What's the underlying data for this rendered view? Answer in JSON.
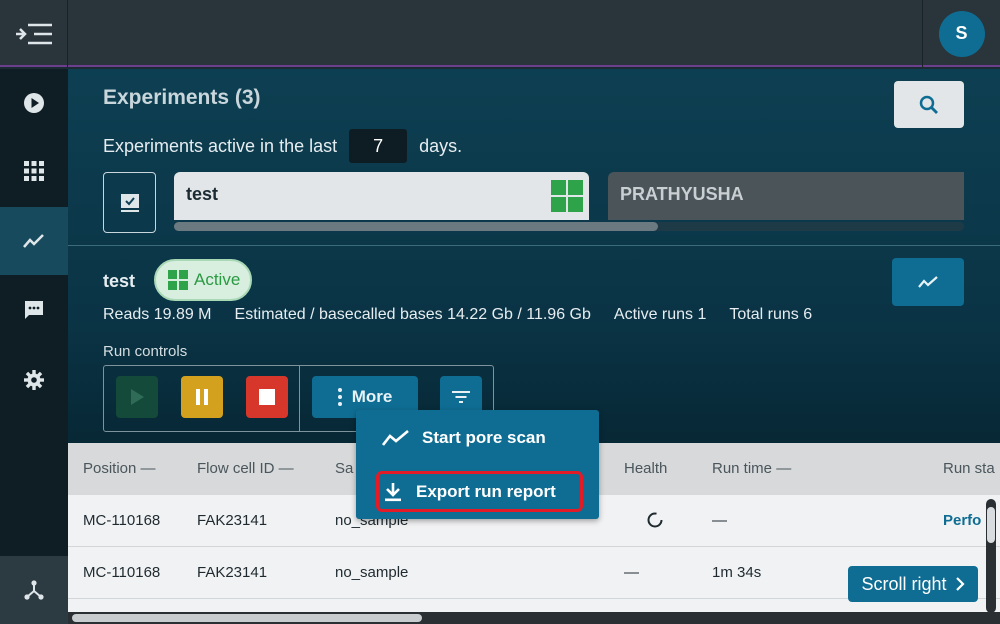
{
  "topbar": {
    "avatar_initial": "S"
  },
  "sidenav": {
    "items": [
      {
        "icon": "play-circle-icon"
      },
      {
        "icon": "grid-icon"
      },
      {
        "icon": "chart-line-icon",
        "active": true
      },
      {
        "icon": "chat-icon"
      },
      {
        "icon": "gear-icon"
      }
    ],
    "bottom_icon": "network-icon"
  },
  "experiments": {
    "title": "Experiments (3)",
    "active_prefix": "Experiments active in the last",
    "active_days": "7",
    "active_suffix": "days.",
    "cards": [
      {
        "name": "test"
      },
      {
        "name": "PRATHYUSHA"
      }
    ]
  },
  "selected": {
    "name": "test",
    "status": "Active",
    "stats": [
      "Reads 19.89 M",
      "Estimated / basecalled bases 14.22 Gb / 11.96 Gb",
      "Active runs 1",
      "Total runs 6"
    ],
    "run_controls_label": "Run controls",
    "more_label": "More"
  },
  "dropdown": {
    "items": [
      {
        "label": "Start pore scan",
        "icon": "pore-scan-icon"
      },
      {
        "label": "Export run report",
        "icon": "download-icon",
        "highlighted": true
      }
    ]
  },
  "table": {
    "headers": [
      "Position —",
      "Flow cell ID —",
      "Sa",
      "Health",
      "Run time —",
      "Run sta"
    ],
    "rows": [
      {
        "position": "MC-110168",
        "flow_cell": "FAK23141",
        "sample": "no_sample",
        "health": "",
        "run_time": "—",
        "status": "Perfo"
      },
      {
        "position": "MC-110168",
        "flow_cell": "FAK23141",
        "sample": "no_sample",
        "health": "—",
        "run_time": "1m 34s",
        "status": ""
      }
    ],
    "scroll_right_label": "Scroll right"
  },
  "colors": {
    "accent": "#0f6d93",
    "active_green": "#2a9a43",
    "stop_red": "#d7372b",
    "pause_yellow": "#d4a11f"
  }
}
